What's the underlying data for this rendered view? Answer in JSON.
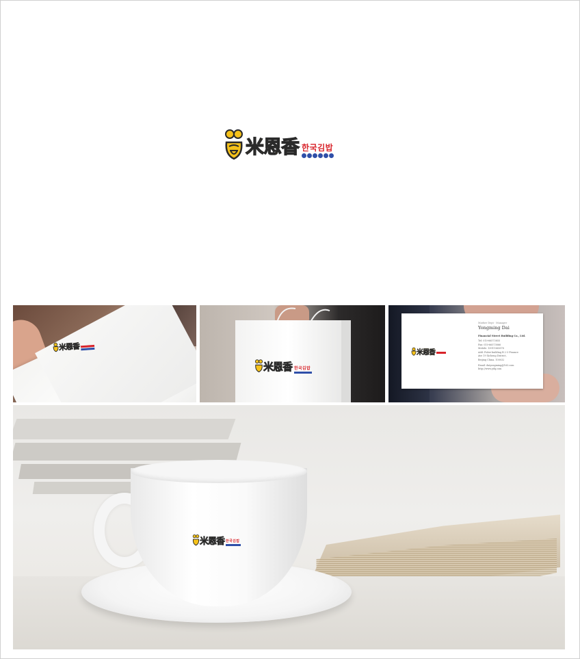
{
  "brand": {
    "chinese_name": "米恩香",
    "korean_tagline": "한국김밥",
    "colors": {
      "logo_yellow": "#f6c21a",
      "logo_red": "#d8232a",
      "logo_blue": "#2f4fa8",
      "outline": "#2a2a2a"
    }
  },
  "mockups": {
    "business_card": {
      "title_line": "Marker Dept · Manager",
      "name": "Yongming Dai",
      "company": "Financial Street Building Co., Ltd.",
      "lines": [
        "Tel: 010-66573855",
        "Fax: 010-66573866",
        "Mobile: 13911565678",
        "Add: Fubei building B 2-3 Finance",
        "Ave 19 Xicheng District,",
        "Beijing China. 100032"
      ],
      "email": "Email: daiyongming@163.com",
      "web": "http://www.ydq.com"
    }
  }
}
